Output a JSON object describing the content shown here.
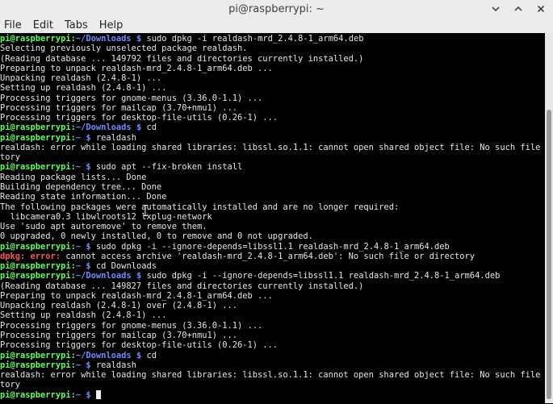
{
  "window": {
    "title": "pi@raspberrypi: ~",
    "controls": [
      {
        "name": "minimize-icon",
        "icon": "chevron-down"
      },
      {
        "name": "maximize-icon",
        "icon": "chevron-up"
      },
      {
        "name": "close-icon",
        "icon": "x"
      }
    ]
  },
  "menubar": {
    "items": [
      "File",
      "Edit",
      "Tabs",
      "Help"
    ]
  },
  "colors": {
    "background": "#000000",
    "text": "#e6e6e6",
    "prompt_user": "#5cff5c",
    "prompt_path": "#6f8cff",
    "error": "#ff5555"
  },
  "terminal": {
    "lines": [
      {
        "type": "prompt",
        "user": "pi@raspberrypi",
        "path": "~/Downloads",
        "cmd": "sudo dpkg -i realdash-mrd_2.4.8-1_arm64.deb"
      },
      {
        "type": "out",
        "text": "Selecting previously unselected package realdash."
      },
      {
        "type": "out",
        "text": "(Reading database ... 149792 files and directories currently installed.)"
      },
      {
        "type": "out",
        "text": "Preparing to unpack realdash-mrd_2.4.8-1_arm64.deb ..."
      },
      {
        "type": "out",
        "text": "Unpacking realdash (2.4.8-1) ..."
      },
      {
        "type": "out",
        "text": "Setting up realdash (2.4.8-1) ..."
      },
      {
        "type": "out",
        "text": "Processing triggers for gnome-menus (3.36.0-1.1) ..."
      },
      {
        "type": "out",
        "text": "Processing triggers for mailcap (3.70+nmu1) ..."
      },
      {
        "type": "out",
        "text": "Processing triggers for desktop-file-utils (0.26-1) ..."
      },
      {
        "type": "prompt",
        "user": "pi@raspberrypi",
        "path": "~/Downloads",
        "cmd": "cd"
      },
      {
        "type": "prompt",
        "user": "pi@raspberrypi",
        "path": "~",
        "cmd": "realdash"
      },
      {
        "type": "out",
        "text": "realdash: error while loading shared libraries: libssl.so.1.1: cannot open shared object file: No such file or direc"
      },
      {
        "type": "out",
        "text": "tory"
      },
      {
        "type": "prompt",
        "user": "pi@raspberrypi",
        "path": "~",
        "cmd": "sudo apt --fix-broken install"
      },
      {
        "type": "out",
        "text": "Reading package lists... Done"
      },
      {
        "type": "out",
        "text": "Building dependency tree... Done"
      },
      {
        "type": "out",
        "text": "Reading state information... Done"
      },
      {
        "type": "out",
        "text": "The following packages were automatically installed and are no longer required:"
      },
      {
        "type": "out",
        "text": "  libcamera0.3 libwlroots12 lxplug-network"
      },
      {
        "type": "out",
        "text": "Use 'sudo apt autoremove' to remove them."
      },
      {
        "type": "out",
        "text": "0 upgraded, 0 newly installed, 0 to remove and 0 not upgraded."
      },
      {
        "type": "prompt",
        "user": "pi@raspberrypi",
        "path": "~",
        "cmd": "sudo dpkg -i --ignore-depends=libssl1.1 realdash-mrd_2.4.8-1_arm64.deb"
      },
      {
        "type": "error",
        "label": "dpkg: error:",
        "text": " cannot access archive 'realdash-mrd_2.4.8-1_arm64.deb': No such file or directory"
      },
      {
        "type": "prompt",
        "user": "pi@raspberrypi",
        "path": "~",
        "cmd": "cd Downloads"
      },
      {
        "type": "prompt",
        "user": "pi@raspberrypi",
        "path": "~/Downloads",
        "cmd": "sudo dpkg -i --ignore-depends=libssl1.1 realdash-mrd_2.4.8-1_arm64.deb"
      },
      {
        "type": "out",
        "text": "(Reading database ... 149827 files and directories currently installed.)"
      },
      {
        "type": "out",
        "text": "Preparing to unpack realdash-mrd_2.4.8-1_arm64.deb ..."
      },
      {
        "type": "out",
        "text": "Unpacking realdash (2.4.8-1) over (2.4.8-1) ..."
      },
      {
        "type": "out",
        "text": "Setting up realdash (2.4.8-1) ..."
      },
      {
        "type": "out",
        "text": "Processing triggers for gnome-menus (3.36.0-1.1) ..."
      },
      {
        "type": "out",
        "text": "Processing triggers for mailcap (3.70+nmu1) ..."
      },
      {
        "type": "out",
        "text": "Processing triggers for desktop-file-utils (0.26-1) ..."
      },
      {
        "type": "prompt",
        "user": "pi@raspberrypi",
        "path": "~/Downloads",
        "cmd": "cd"
      },
      {
        "type": "prompt",
        "user": "pi@raspberrypi",
        "path": "~",
        "cmd": "realdash"
      },
      {
        "type": "out",
        "text": "realdash: error while loading shared libraries: libssl.so.1.1: cannot open shared object file: No such file or direc"
      },
      {
        "type": "out",
        "text": "tory"
      },
      {
        "type": "prompt",
        "user": "pi@raspberrypi",
        "path": "~",
        "cmd": "",
        "cursor": true
      }
    ]
  }
}
